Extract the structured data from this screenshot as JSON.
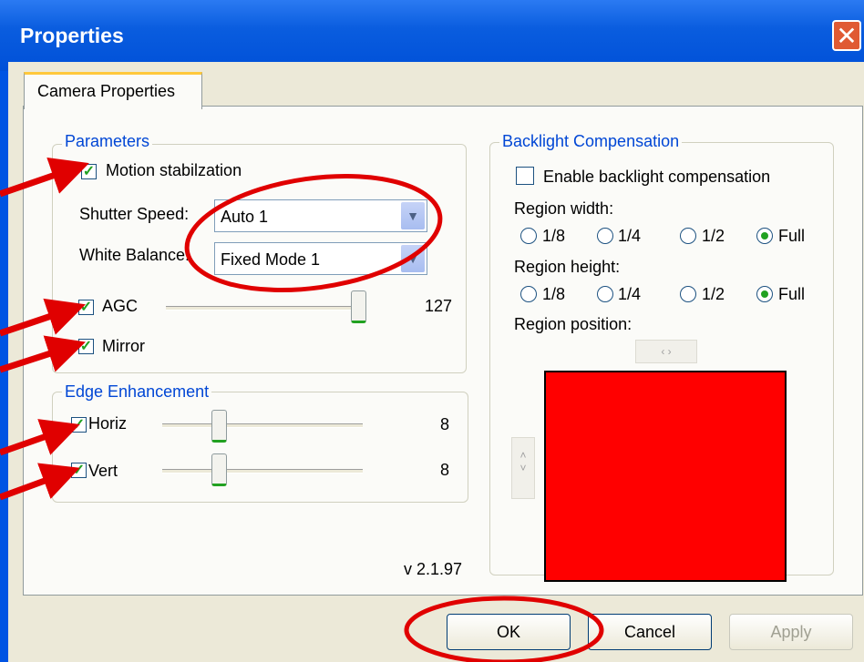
{
  "window": {
    "title": "Properties",
    "close_icon": "close-icon"
  },
  "tabs": [
    {
      "label": "Camera Properties",
      "active": true
    }
  ],
  "parameters": {
    "legend": "Parameters",
    "motion_label": "Motion stabilzation",
    "motion_checked": true,
    "shutter_label": "Shutter Speed:",
    "shutter_value": "Auto 1",
    "white_balance_label": "White Balance:",
    "white_balance_value": "Fixed Mode 1",
    "agc_label": "AGC",
    "agc_checked": true,
    "agc_value": "127",
    "mirror_label": "Mirror",
    "mirror_checked": true
  },
  "edge": {
    "legend": "Edge Enhancement",
    "horiz_label": "Horiz",
    "horiz_value": "8",
    "horiz_checked": true,
    "vert_label": "Vert",
    "vert_value": "8",
    "vert_checked": true
  },
  "version": "v 2.1.97",
  "backlight": {
    "legend": "Backlight Compensation",
    "enable_label": "Enable backlight compensation",
    "enable_checked": false,
    "width_label": "Region width:",
    "height_label": "Region height:",
    "options": [
      "1/8",
      "1/4",
      "1/2",
      "Full"
    ],
    "width_selected": "Full",
    "height_selected": "Full",
    "position_label": "Region position:",
    "region_color": "#ff0000"
  },
  "buttons": {
    "ok": "OK",
    "cancel": "Cancel",
    "apply": "Apply"
  },
  "annotation_color": "#e00000"
}
